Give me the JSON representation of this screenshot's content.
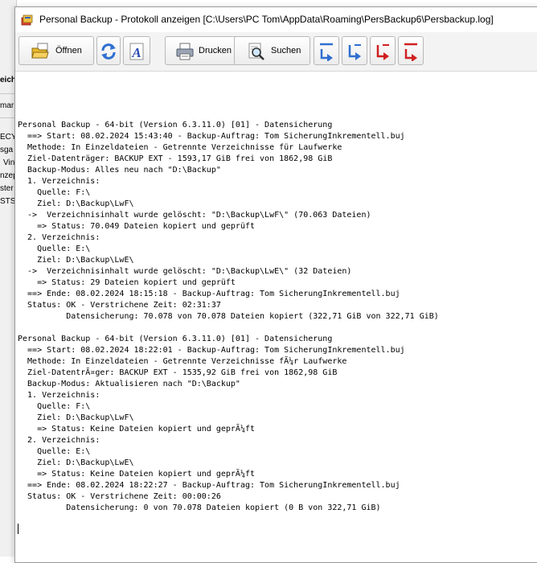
{
  "background_window": {
    "fragments": [
      "eich",
      "mar",
      "ECY",
      "sga",
      "Vin",
      "nzep",
      "ster",
      "STS"
    ]
  },
  "window": {
    "title": "Personal Backup - Protokoll anzeigen [C:\\Users\\PC Tom\\AppData\\Roaming\\PersBackup6\\Persbackup.log]"
  },
  "toolbar": {
    "open_label": "Öffnen",
    "print_label": "Drucken",
    "search_label": "Suchen"
  },
  "icons": {
    "app": "personal-backup-app-icon",
    "open": "open-folder-icon",
    "refresh": "refresh-icon",
    "font": "font-icon",
    "print": "printer-icon",
    "search": "search-icon",
    "first": "go-first-icon",
    "prev": "go-previous-icon",
    "next": "go-next-icon",
    "last": "go-last-icon"
  },
  "colors": {
    "accent_blue": "#2f6fd0",
    "accent_red": "#d02020"
  },
  "log": {
    "lines": [
      "Personal Backup - 64-bit (Version 6.3.11.0) [01] - Datensicherung",
      "  ==> Start: 08.02.2024 15:43:40 - Backup-Auftrag: Tom SicherungInkrementell.buj",
      "  Methode: In Einzeldateien - Getrennte Verzeichnisse für Laufwerke",
      "  Ziel-Datenträger: BACKUP EXT - 1593,17 GiB frei von 1862,98 GiB",
      "  Backup-Modus: Alles neu nach \"D:\\Backup\"",
      "  1. Verzeichnis:",
      "    Quelle: F:\\",
      "    Ziel: D:\\Backup\\LwF\\",
      "  ->  Verzeichnisinhalt wurde gelöscht: \"D:\\Backup\\LwF\\\" (70.063 Dateien)",
      "    => Status: 70.049 Dateien kopiert und geprüft",
      "  2. Verzeichnis:",
      "    Quelle: E:\\",
      "    Ziel: D:\\Backup\\LwE\\",
      "  ->  Verzeichnisinhalt wurde gelöscht: \"D:\\Backup\\LwE\\\" (32 Dateien)",
      "    => Status: 29 Dateien kopiert und geprüft",
      "  ==> Ende: 08.02.2024 18:15:18 - Backup-Auftrag: Tom SicherungInkrementell.buj",
      "  Status: OK - Verstrichene Zeit: 02:31:37",
      "          Datensicherung: 70.078 von 70.078 Dateien kopiert (322,71 GiB von 322,71 GiB)",
      "",
      "Personal Backup - 64-bit (Version 6.3.11.0) [01] - Datensicherung",
      "  ==> Start: 08.02.2024 18:22:01 - Backup-Auftrag: Tom SicherungInkrementell.buj",
      "  Methode: In Einzeldateien - Getrennte Verzeichnisse fÃ¼r Laufwerke",
      "  Ziel-DatentrÃ¤ger: BACKUP EXT - 1535,92 GiB frei von 1862,98 GiB",
      "  Backup-Modus: Aktualisieren nach \"D:\\Backup\"",
      "  1. Verzeichnis:",
      "    Quelle: F:\\",
      "    Ziel: D:\\Backup\\LwF\\",
      "    => Status: Keine Dateien kopiert und geprÃ¼ft",
      "  2. Verzeichnis:",
      "    Quelle: E:\\",
      "    Ziel: D:\\Backup\\LwE\\",
      "    => Status: Keine Dateien kopiert und geprÃ¼ft",
      "  ==> Ende: 08.02.2024 18:22:27 - Backup-Auftrag: Tom SicherungInkrementell.buj",
      "  Status: OK - Verstrichene Zeit: 00:00:26",
      "          Datensicherung: 0 von 70.078 Dateien kopiert (0 B von 322,71 GiB)"
    ]
  }
}
